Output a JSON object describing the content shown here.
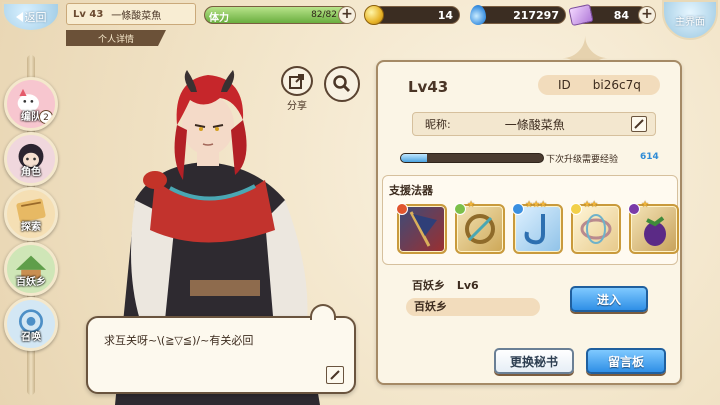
{
  "top": {
    "back_label": "返回",
    "level": "Lv 43",
    "name": "一條酸菜魚",
    "sub_tab": "个人详情",
    "stamina_label": "体力",
    "stamina_value": "82/82",
    "stamina_fraction": 1.0,
    "coins": "14",
    "crystals": "217297",
    "tickets": "84",
    "home_label": "主界面"
  },
  "sidebar": {
    "items": [
      {
        "label": "编队",
        "badge": "2"
      },
      {
        "label": "角色"
      },
      {
        "label": "探索"
      },
      {
        "label": "百妖乡"
      },
      {
        "label": "召唤"
      }
    ]
  },
  "actions": {
    "share_label": "分享"
  },
  "speech": {
    "text": "求互关呀~\\(≧▽≦)/~有关必回"
  },
  "profile": {
    "level": "Lv43",
    "id_label": "ID",
    "id_value": "bi26c7q",
    "nickname_label": "昵称:",
    "nickname": "一條酸菜魚",
    "exp_fraction": 0.18,
    "exp_label": "下次升级需要经验",
    "exp_needed": "614",
    "support_title": "支援法器",
    "weapons": [
      {
        "icon": "flag-weapon",
        "element": "fire",
        "stars": ""
      },
      {
        "icon": "ring-weapon",
        "element": "wind",
        "stars": "★"
      },
      {
        "icon": "hook-weapon",
        "element": "water",
        "stars": "★★★"
      },
      {
        "icon": "thread-weapon",
        "element": "light",
        "stars": "★★"
      },
      {
        "icon": "eggplant-weapon",
        "element": "dark",
        "stars": "★"
      }
    ],
    "yokai_name": "百妖乡",
    "yokai_level": "Lv6",
    "yokai_pill": "百妖乡",
    "enter_label": "进入",
    "change_secretary_label": "更换秘书",
    "message_board_label": "留言板"
  },
  "colors": {
    "accent_blue": "#2f8fe6",
    "exp_value": "#2f8bd6",
    "panel_bg": "#fbf5e6"
  }
}
